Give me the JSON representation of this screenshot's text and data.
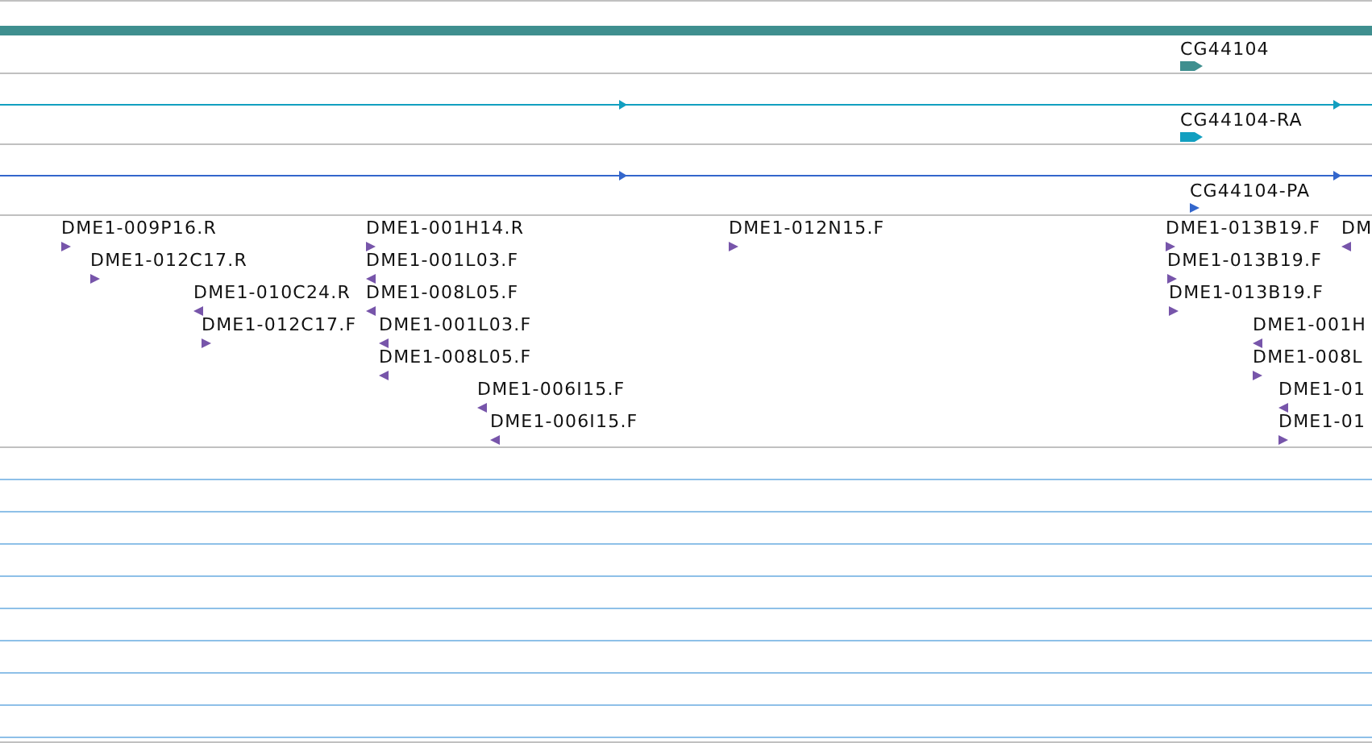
{
  "tracks": [
    {
      "kind": "gene",
      "color": "#3f8f8f",
      "features": [
        {
          "label": "CG44104",
          "reverse": false
        }
      ]
    },
    {
      "kind": "transcript",
      "color": "#129fc0",
      "features": [
        {
          "label": "CG44104-RA",
          "reverse": false
        }
      ]
    },
    {
      "kind": "transcript",
      "color": "#3366cc",
      "features": [
        {
          "label": "CG44104-PA",
          "reverse": false
        }
      ]
    },
    {
      "kind": "clones",
      "color": "#7755aa",
      "rows": [
        [
          {
            "label": "DME1-009P16.R",
            "reverse": false
          },
          {
            "label": "DME1-001H14.R",
            "reverse": false
          },
          {
            "label": "DME1-012N15.F",
            "reverse": false
          },
          {
            "label": "DME1-013B19.F",
            "reverse": false
          },
          {
            "label": "DM",
            "reverse": true
          }
        ],
        [
          {
            "label": "DME1-012C17.R",
            "reverse": false
          },
          {
            "label": "DME1-001L03.F",
            "reverse": true
          },
          {
            "label": "DME1-013B19.F",
            "reverse": false
          }
        ],
        [
          {
            "label": "DME1-010C24.R",
            "reverse": true
          },
          {
            "label": "DME1-008L05.F",
            "reverse": true
          },
          {
            "label": "DME1-013B19.F",
            "reverse": false
          }
        ],
        [
          {
            "label": "DME1-012C17.F",
            "reverse": false
          },
          {
            "label": "DME1-001L03.F",
            "reverse": true
          },
          {
            "label": "DME1-001H",
            "reverse": true
          }
        ],
        [
          {
            "label": "DME1-008L05.F",
            "reverse": true
          },
          {
            "label": "DME1-008L",
            "reverse": false
          }
        ],
        [
          {
            "label": "DME1-006I15.F",
            "reverse": true
          },
          {
            "label": "DME1-01",
            "reverse": true
          }
        ],
        [
          {
            "label": "DME1-006I15.F",
            "reverse": true
          },
          {
            "label": "DME1-01",
            "reverse": false
          }
        ]
      ]
    },
    {
      "kind": "empty",
      "color": "#8ec0e8"
    }
  ]
}
